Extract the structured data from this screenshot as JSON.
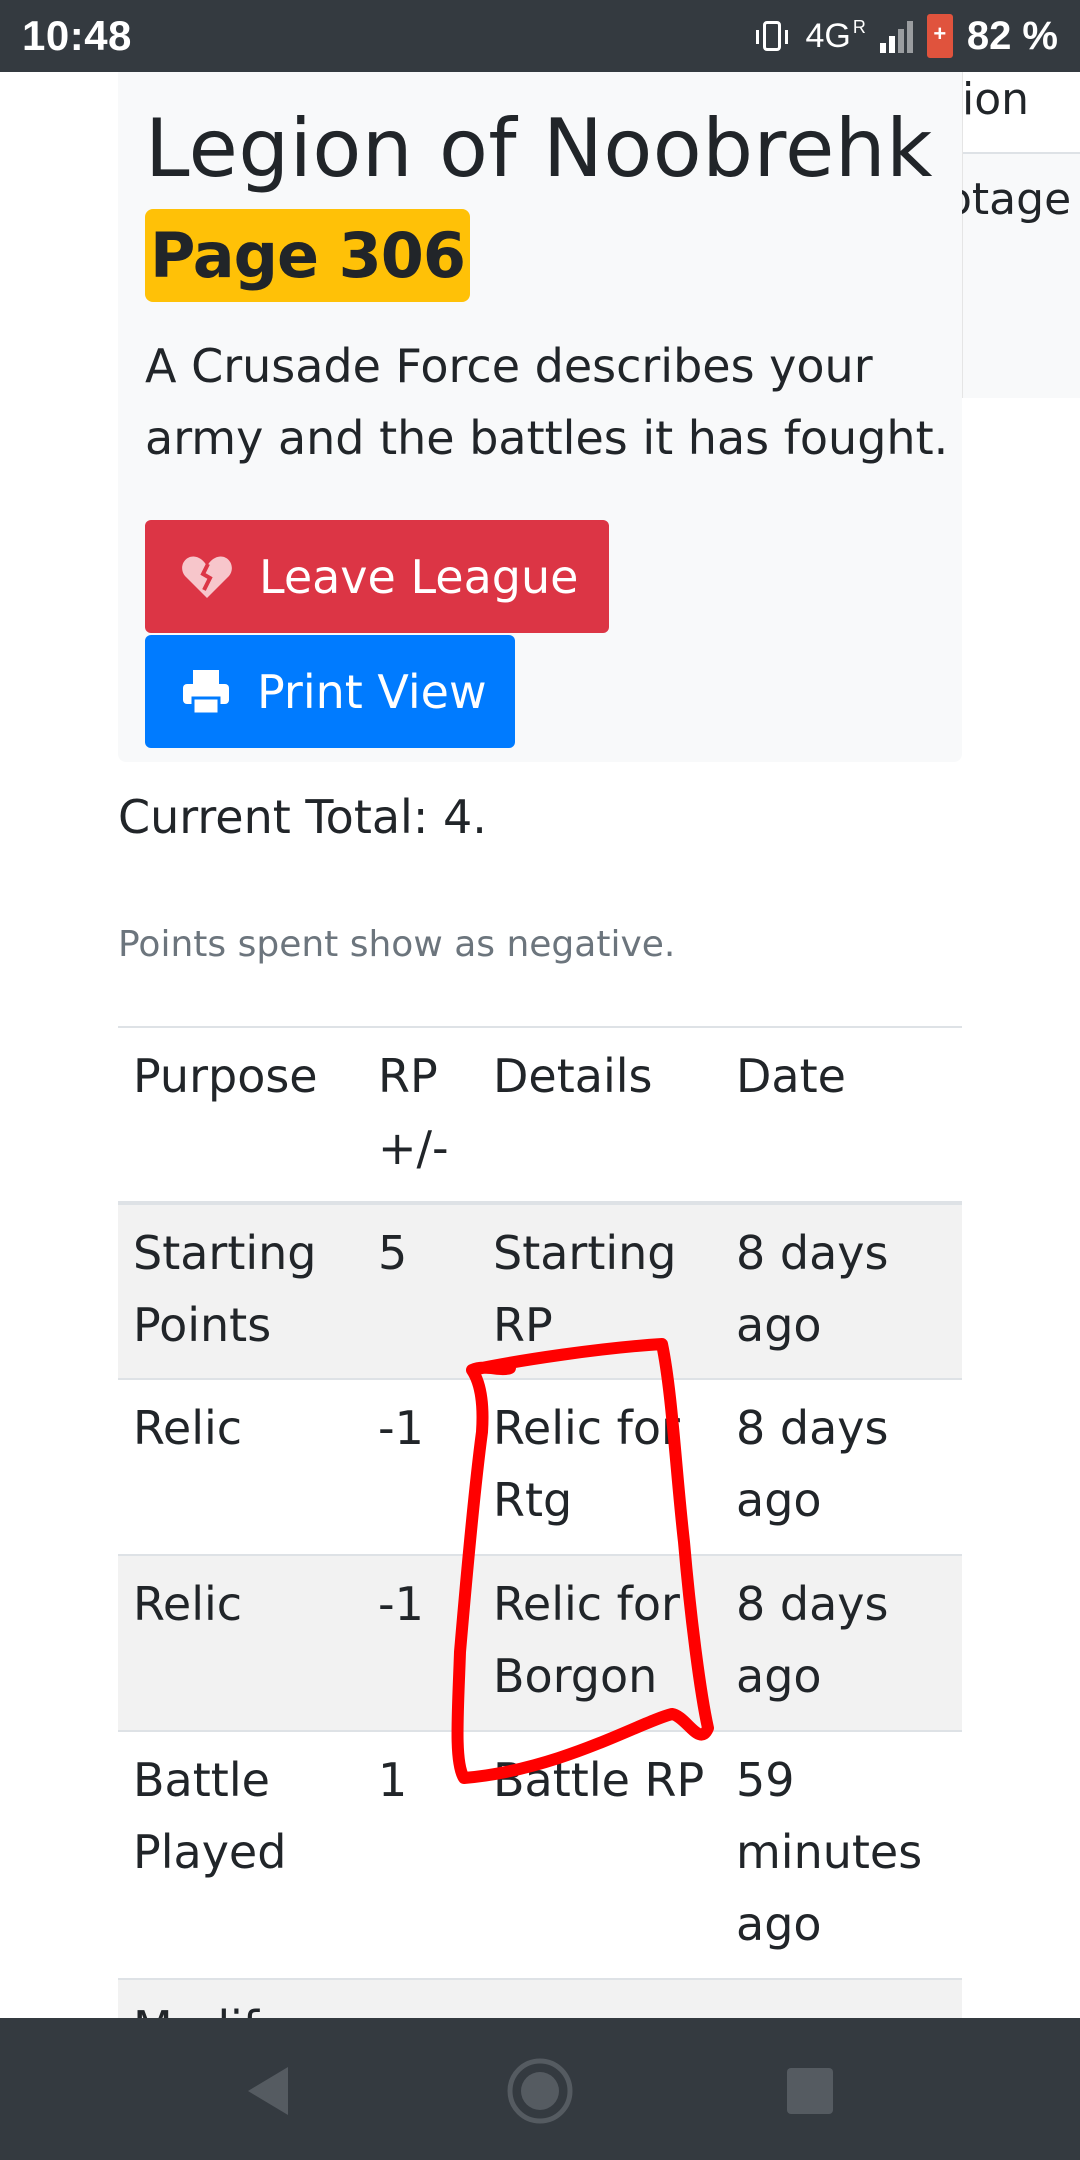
{
  "status_bar": {
    "time": "10:48",
    "network": "4G",
    "roaming": "R",
    "battery_percent": "82 %",
    "icons": [
      "vibrate-icon",
      "signal-icon",
      "battery-saver-icon"
    ]
  },
  "header": {
    "title": "Legion of Noobrehk",
    "page_badge": "Page 306",
    "description": "A Crusade Force describes your army and the battles it has fought.",
    "buttons": {
      "leave_label": "Leave League",
      "leave_icon": "broken-heart-icon",
      "print_label": "Print View",
      "print_icon": "printer-icon"
    }
  },
  "side_peek": {
    "line1": "ion",
    "line2": "otage"
  },
  "points": {
    "current_total": "Current Total: 4.",
    "note": "Points spent show as negative.",
    "columns": [
      "Purpose",
      "RP +/-",
      "Details",
      "Date"
    ],
    "rows": [
      {
        "purpose": "Starting Points",
        "rp": "5",
        "details": "Starting RP",
        "date": "8 days ago"
      },
      {
        "purpose": "Relic",
        "rp": "-1",
        "details": "Relic for Rtg",
        "date": "8 days ago"
      },
      {
        "purpose": "Relic",
        "rp": "-1",
        "details": "Relic for Borgon",
        "date": "8 days ago"
      },
      {
        "purpose": "Battle Played",
        "rp": "1",
        "details": "Battle RP",
        "date": "59 minutes ago"
      },
      {
        "purpose": "Modif",
        "rp": "",
        "details": "",
        "date": ""
      }
    ]
  },
  "annotation": {
    "color": "#ff0000"
  },
  "nav_bar": {
    "icons": [
      "back-icon",
      "home-icon",
      "recents-icon"
    ]
  },
  "colors": {
    "danger": "#dc3545",
    "primary": "#007bff",
    "warning": "#ffc107",
    "muted": "#6c757d"
  }
}
